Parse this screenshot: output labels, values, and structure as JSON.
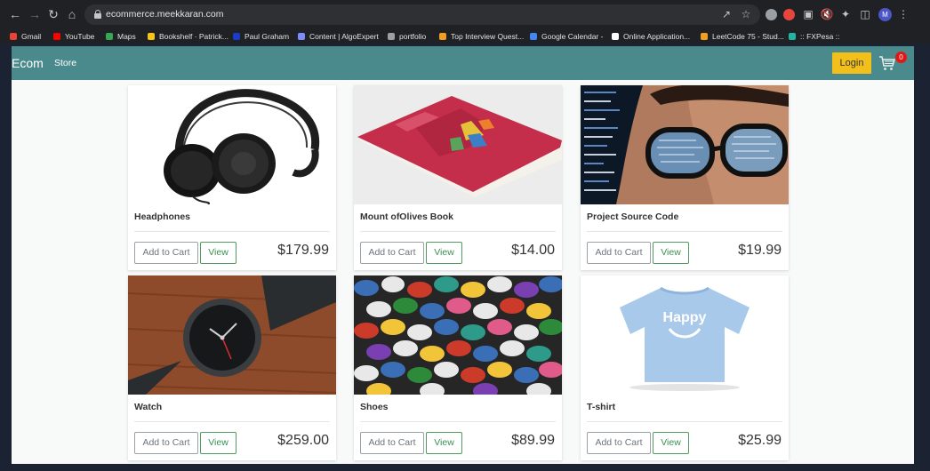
{
  "browser": {
    "url": "ecommerce.meekkaran.com",
    "profile_initial": "M",
    "bookmarks": [
      {
        "label": "Gmail",
        "color": "#ea4335"
      },
      {
        "label": "YouTube",
        "color": "#ff0000"
      },
      {
        "label": "Maps",
        "color": "#34a853"
      },
      {
        "label": "Bookshelf · Patrick...",
        "color": "#f5c518"
      },
      {
        "label": "Paul Graham",
        "color": "#1a3cc8"
      },
      {
        "label": "Content | AlgoExpert",
        "color": "#7b8cff"
      },
      {
        "label": "portfolio",
        "color": "#9aa0a6"
      },
      {
        "label": "Top Interview Quest...",
        "color": "#f0a020"
      },
      {
        "label": "Google Calendar -",
        "color": "#4285f4"
      },
      {
        "label": "Online Application...",
        "color": "#ffffff"
      },
      {
        "label": "LeetCode 75 - Stud...",
        "color": "#f0a020"
      },
      {
        "label": ":: FXPesa ::",
        "color": "#1fb5a5"
      }
    ]
  },
  "navbar": {
    "brand": "Ecom",
    "link": "Store",
    "login_label": "Login",
    "cart_count": "0"
  },
  "products": [
    {
      "name": "Headphones",
      "price": "$179.99",
      "image": "headphones-image"
    },
    {
      "name": "Mount ofOlives Book",
      "price": "$14.00",
      "image": "book-image"
    },
    {
      "name": "Project Source Code",
      "price": "$19.99",
      "image": "source-code-image"
    },
    {
      "name": "Watch",
      "price": "$259.00",
      "image": "watch-image"
    },
    {
      "name": "Shoes",
      "price": "$89.99",
      "image": "shoes-image"
    },
    {
      "name": "T-shirt",
      "price": "$25.99",
      "image": "tshirt-image"
    }
  ],
  "buttons": {
    "add_to_cart": "Add to Cart",
    "view": "View"
  },
  "tshirt_print": "Happy",
  "colors": {
    "navbar": "#4b8a8c",
    "login": "#f3bf1a",
    "badge": "#e01717",
    "view_button": "#3a8f4f"
  }
}
